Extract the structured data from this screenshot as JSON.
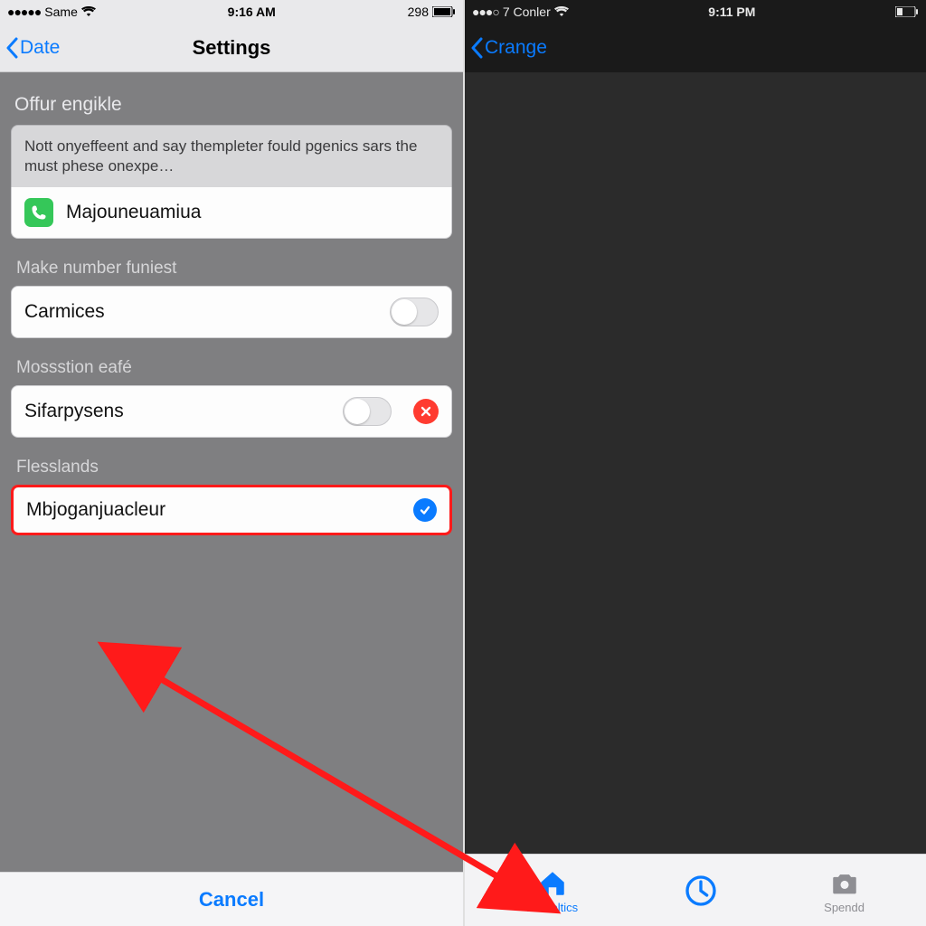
{
  "left": {
    "status": {
      "carrier": "Same",
      "time": "9:16 AM",
      "indicator": "298"
    },
    "nav": {
      "back": "Date",
      "title": "Settings"
    },
    "section1": {
      "header": "Offur engikle",
      "info": "Nott onyeffeent and say thempleter fould pgenics sars the must phese onexpe…",
      "row1": "Majouneuamiua"
    },
    "section2": {
      "header": "Make number funiest",
      "row": "Carmices"
    },
    "section3": {
      "header": "Mossstion eafé",
      "row": "Sifarpysens"
    },
    "section4": {
      "header": "Flesslands",
      "row": "Mbjoganjuacleur"
    },
    "cancel": "Cancel"
  },
  "right": {
    "status": {
      "carrier": "7  Conler",
      "time": "9:11 PM"
    },
    "nav": {
      "back": "Crange"
    },
    "tabs": {
      "home": "Demoltics",
      "clock": "",
      "camera": "Spendd"
    }
  }
}
